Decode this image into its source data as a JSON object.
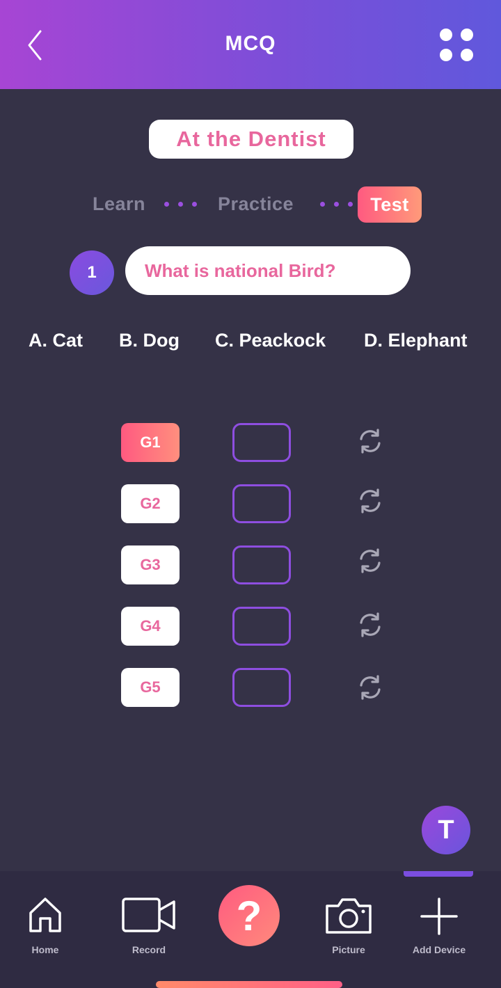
{
  "header": {
    "title": "MCQ"
  },
  "topic": "At the Dentist",
  "steps": {
    "learn": "Learn",
    "practice": "Practice",
    "test": "Test"
  },
  "question": {
    "number": "1",
    "text": "What is national Bird?"
  },
  "options": [
    "A. Cat",
    "B. Dog",
    "C. Peackock",
    "D. Elephant"
  ],
  "groups": [
    {
      "label": "G1",
      "active": true
    },
    {
      "label": "G2",
      "active": false
    },
    {
      "label": "G3",
      "active": false
    },
    {
      "label": "G4",
      "active": false
    },
    {
      "label": "G5",
      "active": false
    }
  ],
  "avatar_letter": "T",
  "nav": {
    "home": "Home",
    "record": "Record",
    "help": "?",
    "picture": "Picture",
    "add_device": "Add Device"
  },
  "colors": {
    "accent_pink": "#e8679d",
    "accent_purple": "#8e4ee0",
    "background": "#353247"
  }
}
